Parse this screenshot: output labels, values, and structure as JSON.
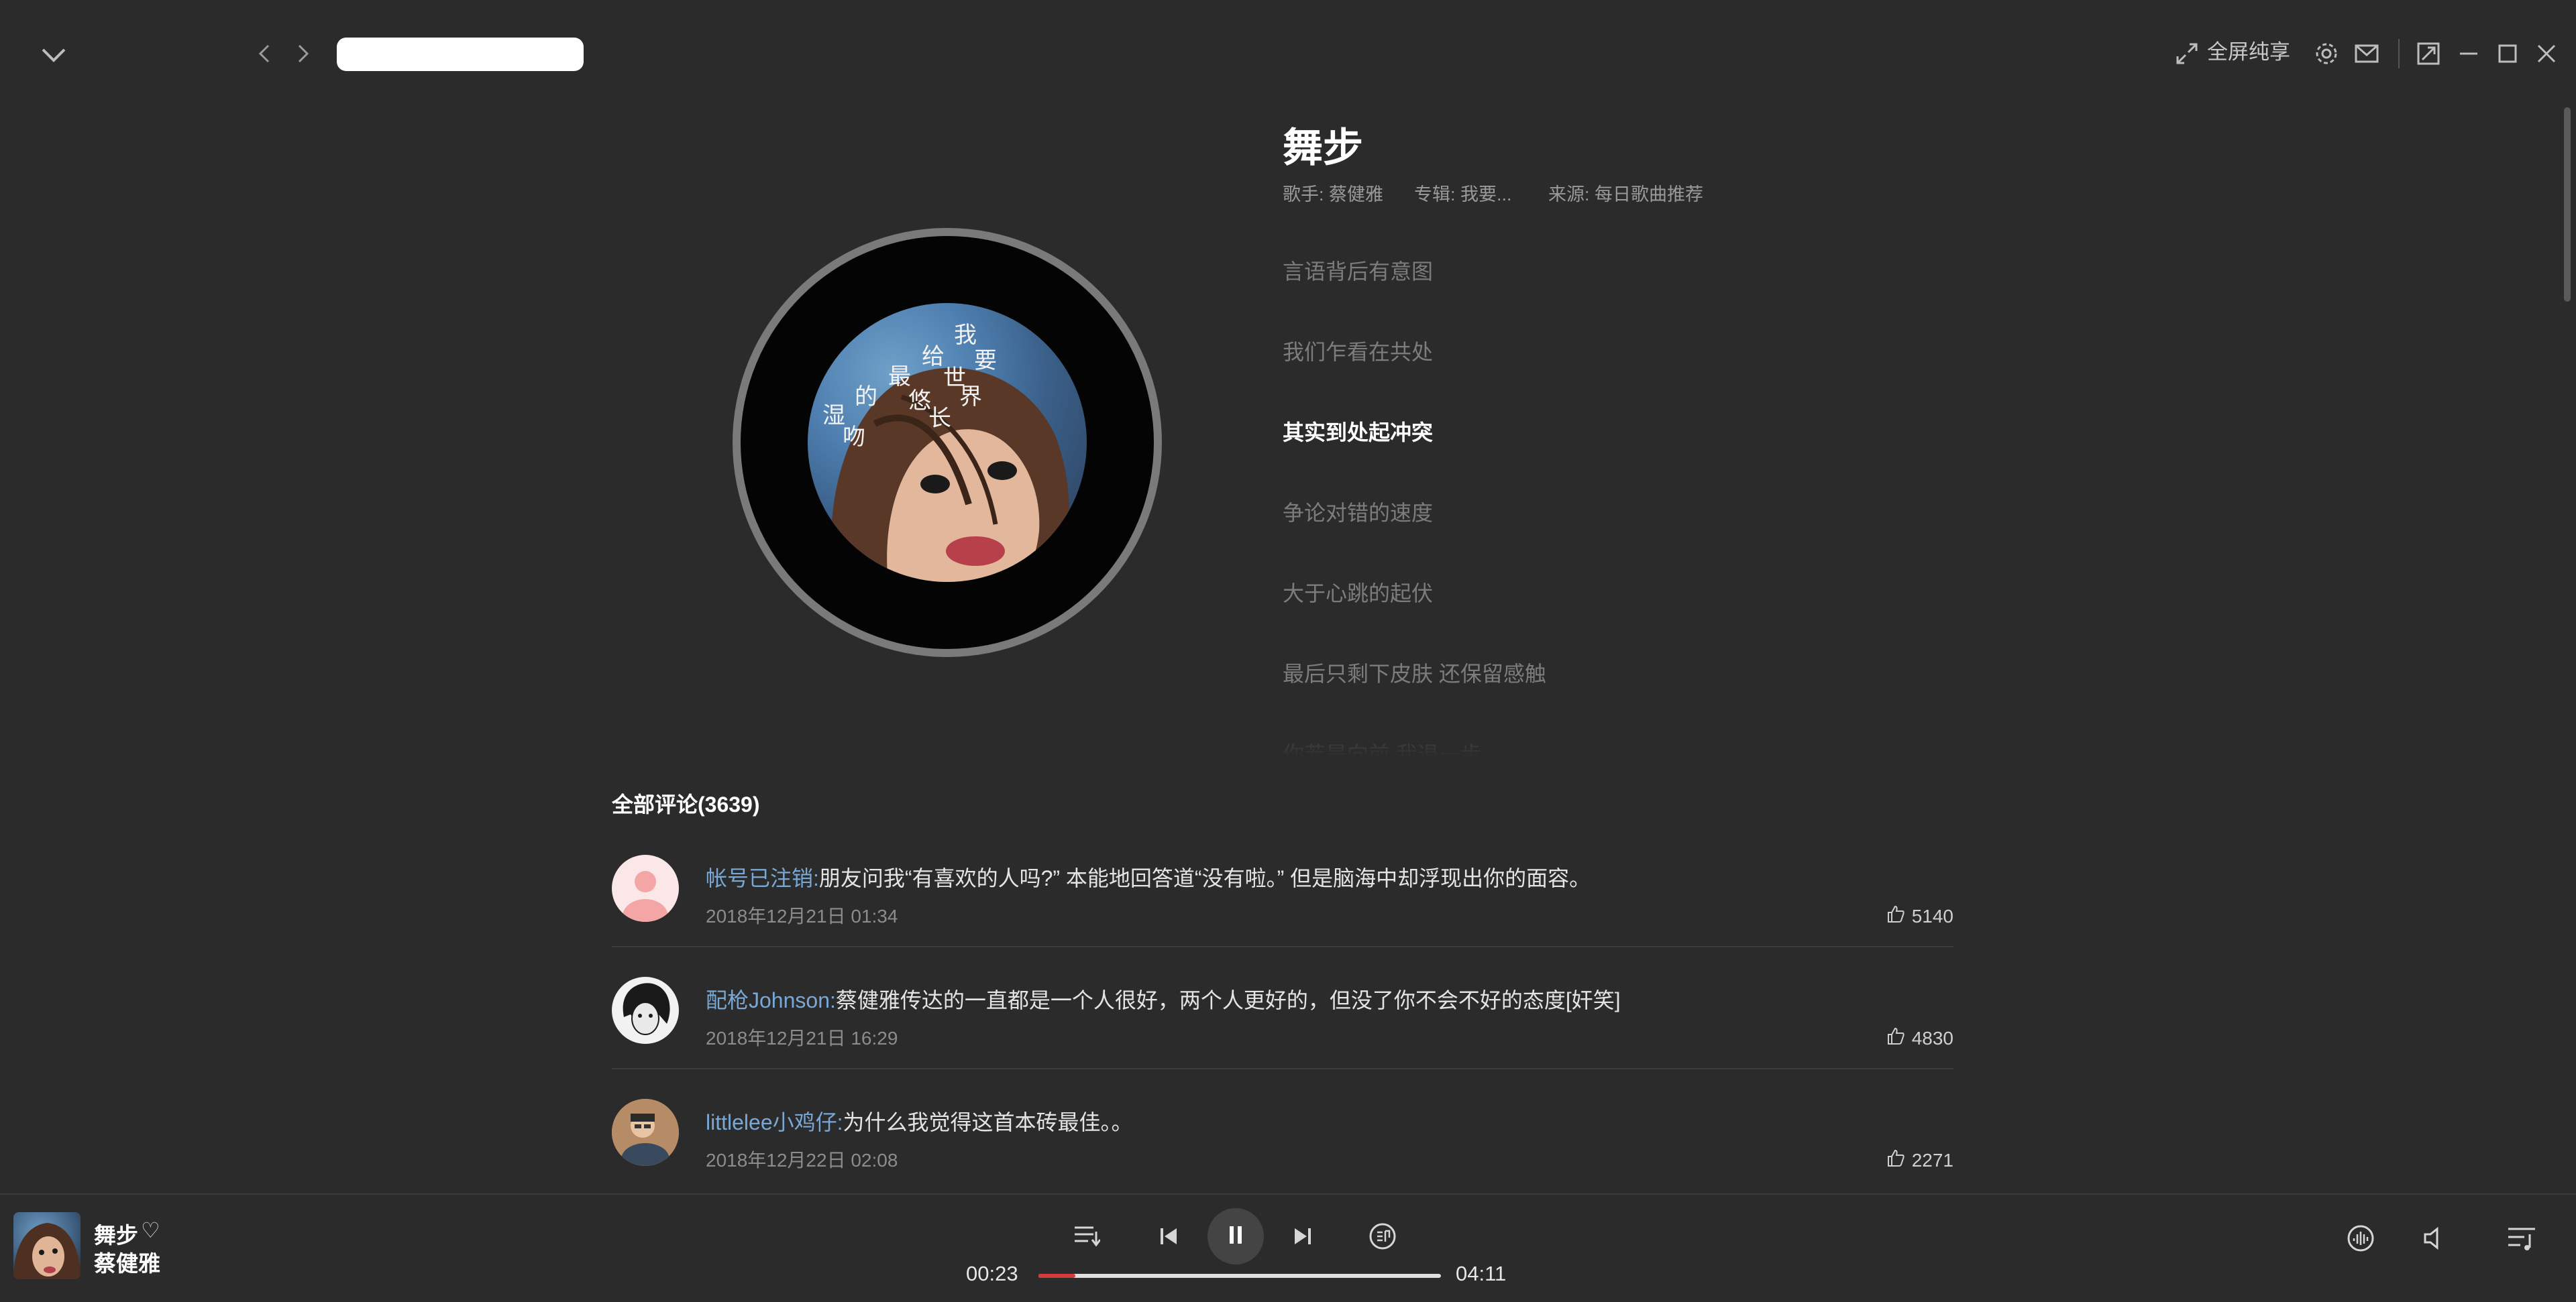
{
  "header": {
    "fullscreen_label": "全屏纯享",
    "search": {
      "value": ""
    }
  },
  "song": {
    "title": "舞步",
    "meta": [
      {
        "label": "歌手:",
        "value": "蔡健雅"
      },
      {
        "label": "专辑:",
        "value": "我要..."
      },
      {
        "label": "来源:",
        "value": "每日歌曲推荐"
      }
    ]
  },
  "cover_text": [
    "我",
    "要",
    "给",
    "世",
    "界",
    "最",
    "悠",
    "长",
    "的",
    "湿",
    "吻"
  ],
  "lyrics": {
    "current_index": 2,
    "lines": [
      "言语背后有意图",
      "我们乍看在共处",
      "其实到处起冲突",
      "争论对错的速度",
      "大于心跳的起伏",
      "最后只剩下皮肤 还保留感触",
      "你若是向前 我退一步"
    ]
  },
  "comments": {
    "header": "全部评论(3639)",
    "items": [
      {
        "user": "帐号已注销",
        "colon": ":",
        "text": "朋友问我“有喜欢的人吗?” 本能地回答道“没有啦。” 但是脑海中却浮现出你的面容。",
        "time": "2018年12月21日 01:34",
        "likes": "5140"
      },
      {
        "user": "配枪Johnson",
        "colon": ":",
        "text": "蔡健雅传达的一直都是一个人很好，两个人更好的，但没了你不会不好的态度[奸笑]",
        "time": "2018年12月21日 16:29",
        "likes": "4830"
      },
      {
        "user": "littlelee小鸡仔",
        "colon": ":",
        "text": "为什么我觉得这首本砖最佳。。",
        "time": "2018年12月22日 02:08",
        "likes": "2271"
      }
    ]
  },
  "player": {
    "title": "舞步",
    "artist": "蔡健雅",
    "heart": "♡",
    "current_time": "00:23",
    "total_time": "04:11",
    "progress_fraction": 0.092,
    "accent_color": "#d43c3c"
  },
  "lyric_scroll_fraction": 0.0
}
